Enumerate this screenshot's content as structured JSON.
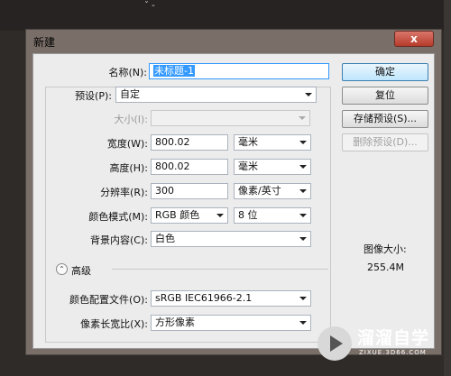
{
  "top_mark": "ˇ ‐",
  "dialog": {
    "title": "新建",
    "close": "x"
  },
  "form": {
    "name": {
      "label": "名称(N):",
      "value": "未标题-1"
    },
    "preset": {
      "label": "预设(P):",
      "value": "自定"
    },
    "size": {
      "label": "大小(I):",
      "value": ""
    },
    "width": {
      "label": "宽度(W):",
      "value": "800.02",
      "unit": "毫米"
    },
    "height": {
      "label": "高度(H):",
      "value": "800.02",
      "unit": "毫米"
    },
    "resolution": {
      "label": "分辨率(R):",
      "value": "300",
      "unit": "像素/英寸"
    },
    "color_mode": {
      "label": "颜色模式(M):",
      "value": "RGB 颜色",
      "depth": "8 位"
    },
    "background": {
      "label": "背景内容(C):",
      "value": "白色"
    },
    "advanced": {
      "label": "高级",
      "icon": "chevron-up-circle-icon"
    },
    "color_profile": {
      "label": "颜色配置文件(O):",
      "value": "sRGB IEC61966-2.1"
    },
    "pixel_aspect": {
      "label": "像素长宽比(X):",
      "value": "方形像素"
    }
  },
  "buttons": {
    "ok": "确定",
    "reset": "复位",
    "save_preset": "存储预设(S)...",
    "delete_preset": "删除预设(D)..."
  },
  "image_size": {
    "label": "图像大小:",
    "value": "255.4M"
  },
  "watermark": {
    "text": "溜溜自学",
    "url": "ZIXUE.3D66.COM"
  },
  "colors": {
    "accent": "#3399ff",
    "default_button": "#bee6fd",
    "close_button": "#c1493a"
  }
}
